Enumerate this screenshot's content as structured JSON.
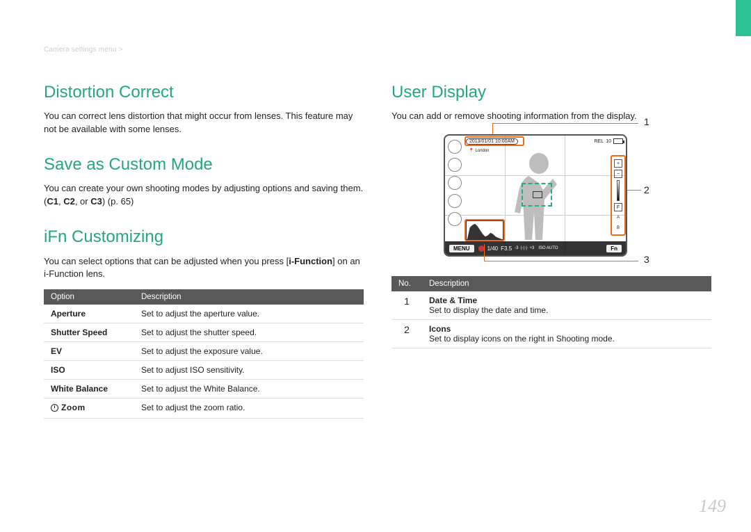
{
  "breadcrumb": "Camera settings menu >",
  "page_number": "149",
  "left": {
    "h1": "Distortion Correct",
    "p1": "You can correct lens distortion that might occur from lenses. This feature may not be available with some lenses.",
    "h2": "Save as Custom Mode",
    "p2_a": "You can create your own shooting modes by adjusting options and saving them. (",
    "p2_b": "C1",
    "p2_c": ", ",
    "p2_d": "C2",
    "p2_e": ", or ",
    "p2_f": "C3",
    "p2_g": ") (p. 65)",
    "h3": "iFn Customizing",
    "p3_a": "You can select options that can be adjusted when you press [",
    "p3_b": "i-Function",
    "p3_c": "] on an i-Function lens.",
    "table": {
      "head_opt": "Option",
      "head_desc": "Description",
      "rows": [
        {
          "opt": "Aperture",
          "desc": "Set to adjust the aperture value."
        },
        {
          "opt": "Shutter Speed",
          "desc": "Set to adjust the shutter speed."
        },
        {
          "opt": "EV",
          "desc": "Set to adjust the exposure value."
        },
        {
          "opt": "ISO",
          "desc": "Set to adjust ISO sensitivity."
        },
        {
          "opt": "White Balance",
          "desc": "Set to adjust the White Balance."
        },
        {
          "opt_special": "izoom",
          "opt_text": "Zoom",
          "desc": "Set to adjust the zoom ratio."
        }
      ]
    }
  },
  "right": {
    "h1": "User Display",
    "p1": "You can add or remove shooting information from the display.",
    "screen": {
      "date": "2013/01/01 10:00AM",
      "location_icon": "map-pin-icon",
      "location": "London",
      "rel": "REL",
      "shots": "10",
      "menu": "MENU",
      "fn": "Fn",
      "shutter": "1/40",
      "fstop": "F3.5",
      "ev_label": "-3",
      "ev_label2": "+3",
      "iso": "ISO AUTO",
      "right_icons": [
        "+",
        "−",
        "F",
        "A",
        "B"
      ]
    },
    "callouts": {
      "n1": "1",
      "n2": "2",
      "n3": "3"
    },
    "table": {
      "head_no": "No.",
      "head_desc": "Description",
      "rows": [
        {
          "no": "1",
          "title": "Date & Time",
          "desc": "Set to display the date and time."
        },
        {
          "no": "2",
          "title": "Icons",
          "desc": "Set to display icons on the right in Shooting mode."
        }
      ]
    }
  }
}
